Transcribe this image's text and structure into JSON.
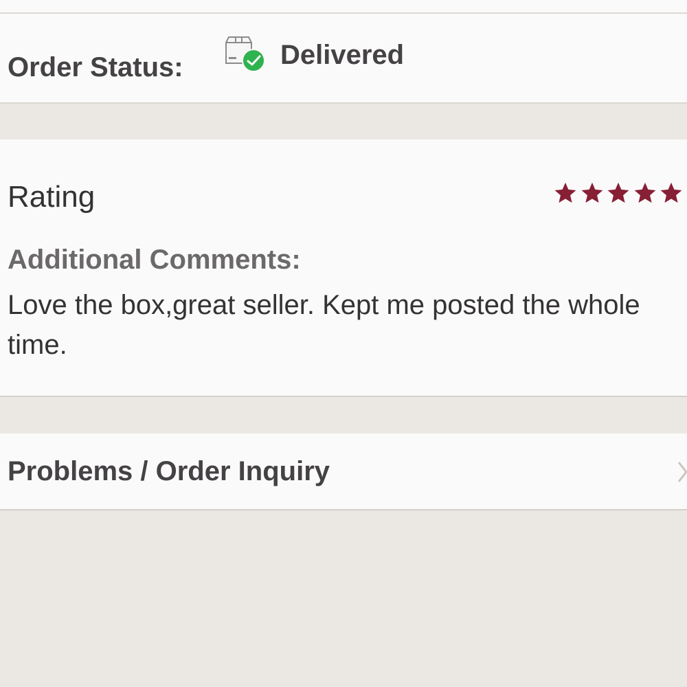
{
  "order_status": {
    "label": "Order Status:",
    "icon": "package-delivered-icon",
    "value": "Delivered",
    "status_color": "#2fb34f"
  },
  "review": {
    "rating_label": "Rating",
    "rating_value": 5,
    "rating_max": 5,
    "star_color": "#871f35",
    "comments_label": "Additional Comments:",
    "comments_text": "Love the box,great seller. Kept me posted the whole time."
  },
  "problems": {
    "label": "Problems / Order Inquiry",
    "icon": "chevron-right-icon"
  }
}
